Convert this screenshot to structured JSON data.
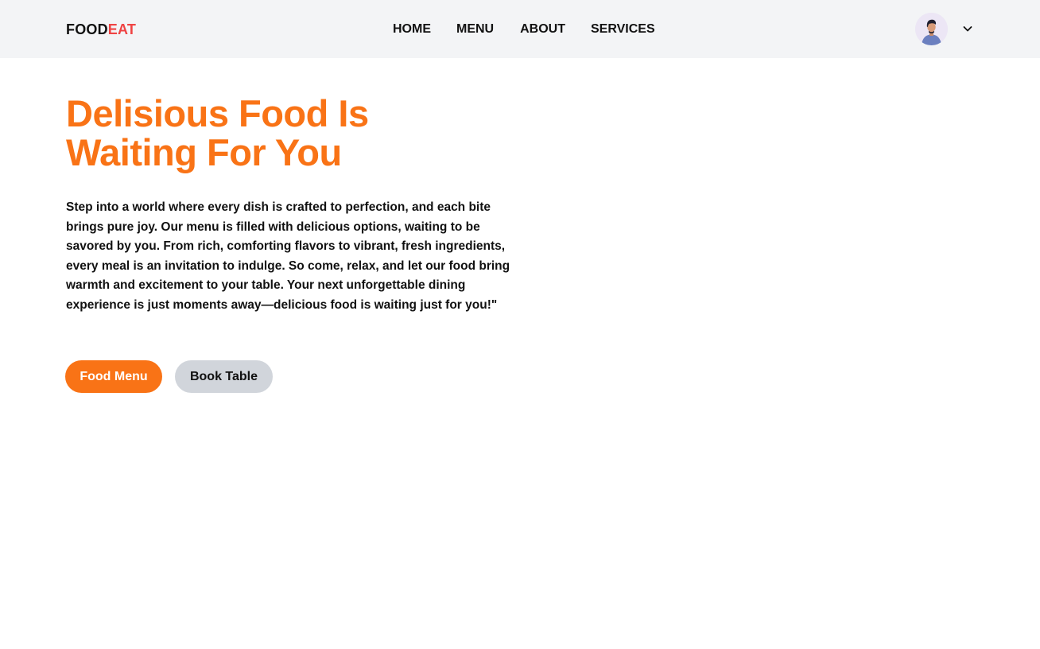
{
  "brand": {
    "name_main": "FOOD",
    "name_accent": "EAT",
    "accent_color": "#ef4444"
  },
  "nav": {
    "items": [
      {
        "label": "HOME"
      },
      {
        "label": "MENU"
      },
      {
        "label": "ABOUT"
      },
      {
        "label": "SERVICES"
      }
    ]
  },
  "user": {
    "avatar_icon": "user-avatar",
    "dropdown_icon": "chevron-down-icon"
  },
  "hero": {
    "title_line1": "Delisious Food Is",
    "title_line2": "Waiting For You",
    "title_color": "#f97316",
    "description": "Step into a world where every dish is crafted to perfection, and each bite brings pure joy. Our menu is filled with delicious options, waiting to be savored by you. From rich, comforting flavors to vibrant, fresh ingredients, every meal is an invitation to indulge. So come, relax, and let our food bring warmth and excitement to your table. Your next unforgettable dining experience is just moments away—delicious food is waiting just for you!\"",
    "primary_button": "Food Menu",
    "secondary_button": "Book Table",
    "primary_color": "#f97316",
    "secondary_color": "#d1d5db"
  }
}
